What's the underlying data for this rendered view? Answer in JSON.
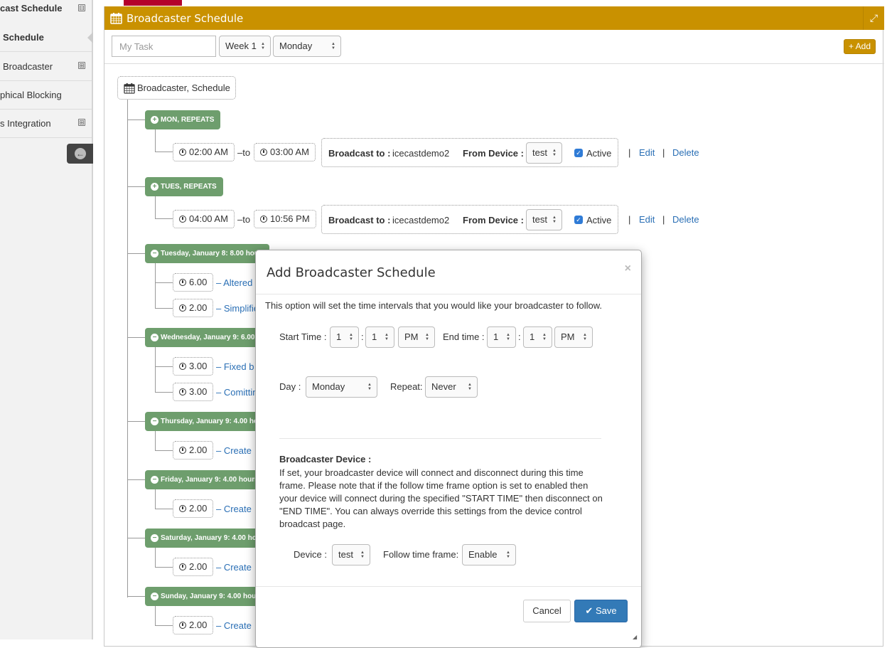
{
  "sidebar": {
    "items": [
      {
        "label": "cast Schedule",
        "expander": "⊟",
        "bold": true
      },
      {
        "label": "Schedule",
        "bold": true,
        "active": true
      },
      {
        "label": "Broadcaster",
        "expander": "⊞"
      },
      {
        "label": "phical Blocking"
      },
      {
        "label": "s Integration",
        "expander": "⊞"
      }
    ],
    "collapse_icon": "arrow-circle-left-icon"
  },
  "panel": {
    "title": "Broadcaster Schedule",
    "header_color": "#c99100",
    "expand_icon": "⤢"
  },
  "toolbar": {
    "task_placeholder": "My Task",
    "week_select": "Week 1",
    "day_select": "Monday",
    "add_label": "+ Add"
  },
  "tree": {
    "root_label": "Broadcaster, Schedule",
    "repeats": [
      {
        "badge": "MON, REPEATS",
        "start": "02:00 AM",
        "to_label": "–to",
        "end": "03:00 AM",
        "broadcast_to_label": "Broadcast to :",
        "broadcast_to": "icecastdemo2",
        "from_device_label": "From Device :",
        "device": "test",
        "active_label": "Active",
        "edit": "Edit",
        "delete": "Delete"
      },
      {
        "badge": "TUES, REPEATS",
        "start": "04:00 AM",
        "to_label": "–to",
        "end": "10:56 PM",
        "broadcast_to_label": "Broadcast to :",
        "broadcast_to": "icecastdemo2",
        "from_device_label": "From Device :",
        "device": "test",
        "active_label": "Active",
        "edit": "Edit",
        "delete": "Delete"
      }
    ],
    "days": [
      {
        "badge": "Tuesday, January 8: 8.00 hou",
        "tasks": [
          {
            "hours": "6.00",
            "text": "– Altered"
          },
          {
            "hours": "2.00",
            "text": "– Simplifie"
          }
        ]
      },
      {
        "badge": "Wednesday, January 9: 6.00",
        "tasks": [
          {
            "hours": "3.00",
            "text": "– Fixed b"
          },
          {
            "hours": "3.00",
            "text": "– Comittin"
          }
        ]
      },
      {
        "badge": "Thursday, January 9: 4.00 ho",
        "tasks": [
          {
            "hours": "2.00",
            "text": "– Create"
          }
        ]
      },
      {
        "badge": "Friday, January 9: 4.00 hours",
        "tasks": [
          {
            "hours": "2.00",
            "text": "– Create"
          }
        ]
      },
      {
        "badge": "Saturday, January 9: 4.00 ho",
        "tasks": [
          {
            "hours": "2.00",
            "text": "– Create"
          }
        ]
      },
      {
        "badge": "Sunday, January 9: 4.00 hour",
        "tasks": [
          {
            "hours": "2.00",
            "text": "– Create"
          }
        ]
      }
    ]
  },
  "modal": {
    "title": "Add Broadcaster Schedule",
    "close": "×",
    "description": "This option will set the time intervals that you would like your broadcaster to follow.",
    "start_time_label": "Start Time :",
    "start_hour": "1",
    "start_minute": "1",
    "start_ampm": "PM",
    "end_time_label": "End time :",
    "end_hour": "1",
    "end_minute": "1",
    "end_ampm": "PM",
    "colon": ":",
    "day_label": "Day :",
    "day_value": "Monday",
    "repeat_label": "Repeat:",
    "repeat_value": "Never",
    "device_section_title": "Broadcaster Device :",
    "device_section_text": "If set, your broadcaster device will connect and disconnect during this time frame. Please note that if the follow time frame option is set to enabled then your device will connect during the specified \"START TIME\" then disconnect on \"END TIME\". You can always override this settings from the device control broadcast page.",
    "device_label": "Device :",
    "device_value": "test",
    "follow_label": "Follow time frame:",
    "follow_value": "Enable",
    "cancel": "Cancel",
    "save": "Save"
  }
}
